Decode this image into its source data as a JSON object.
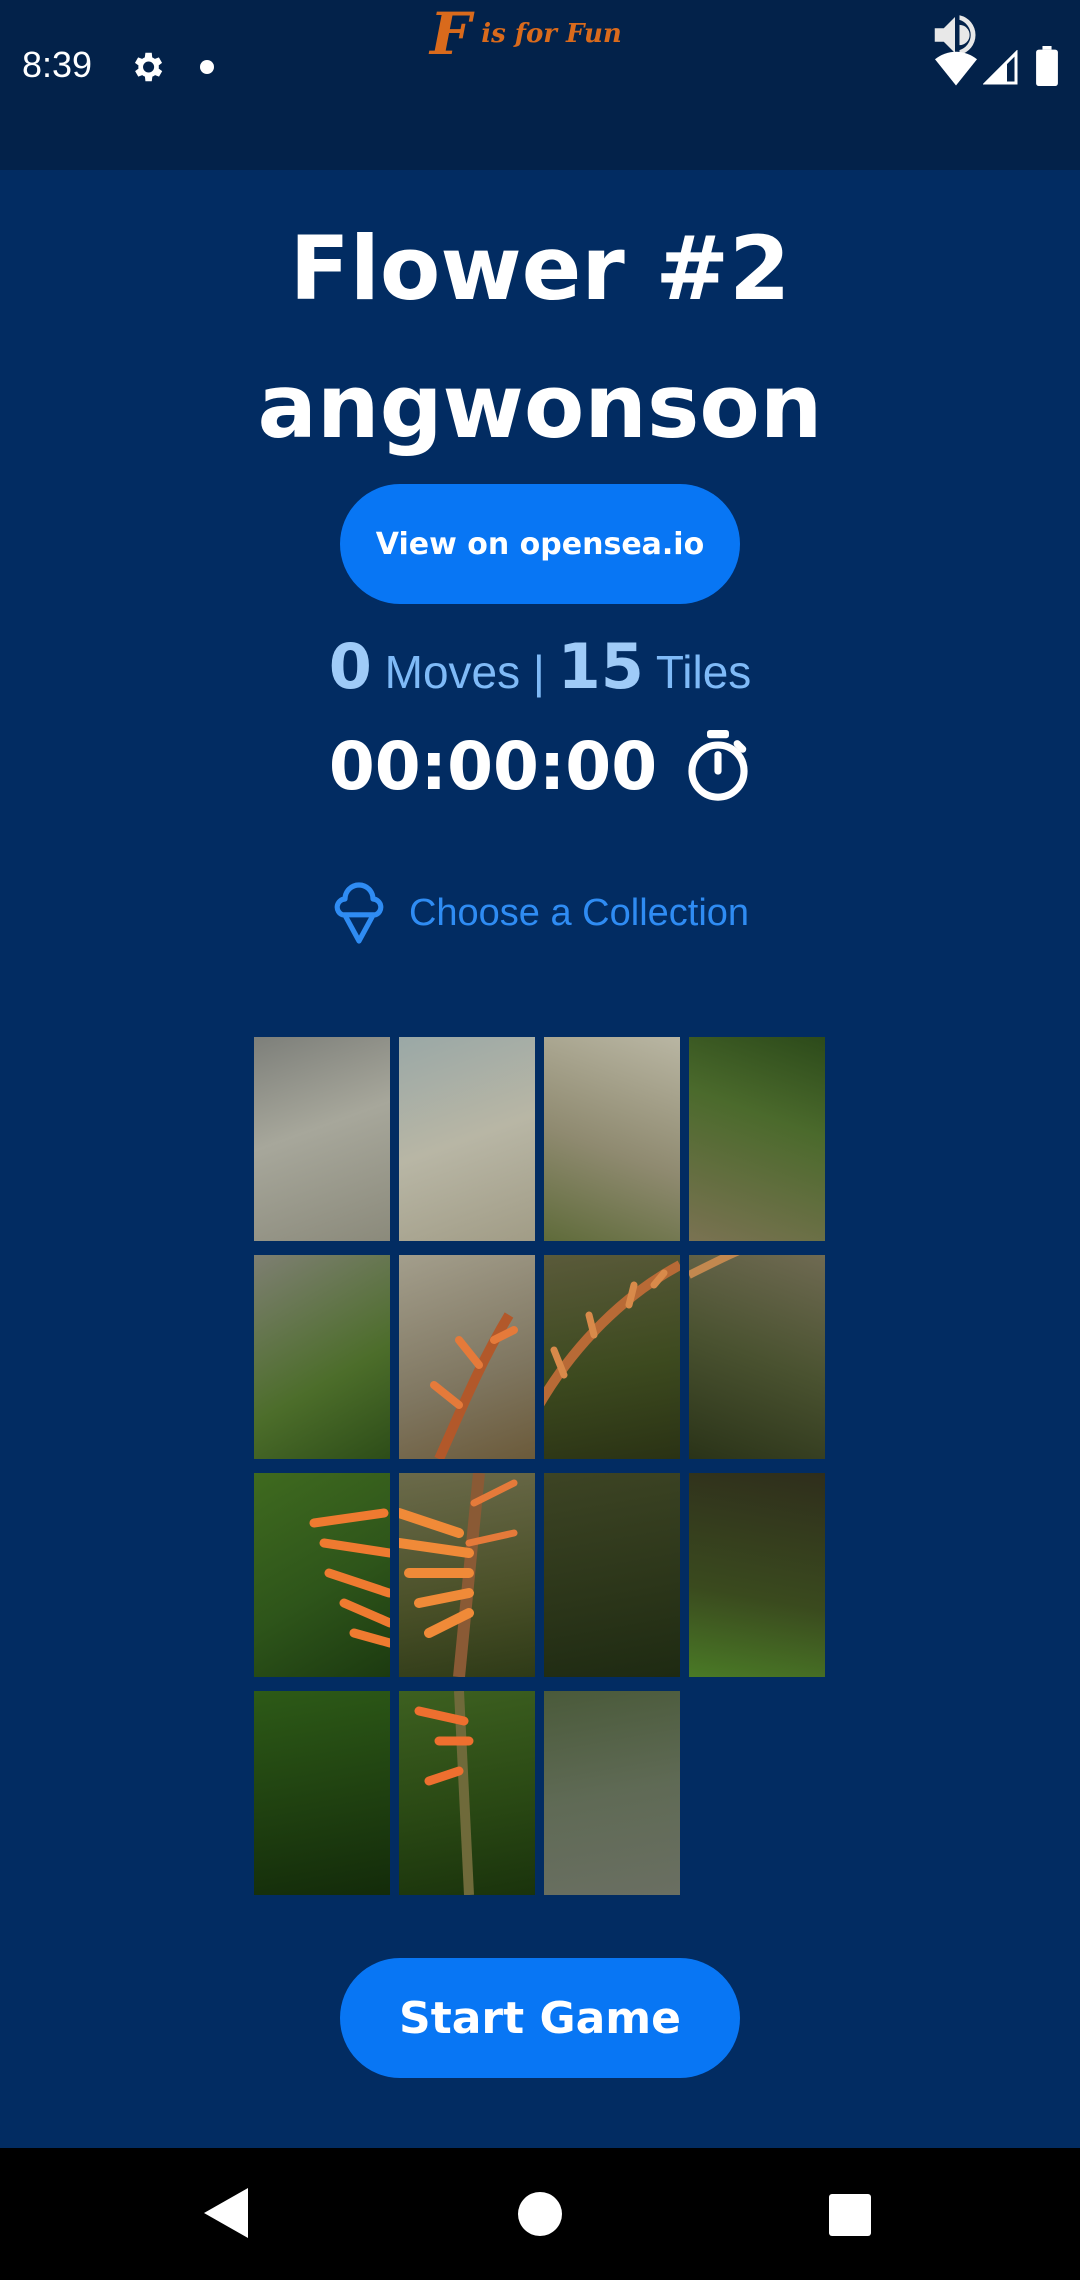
{
  "status_bar": {
    "time": "8:39",
    "icons": [
      "gear-icon",
      "dot-icon",
      "volume-icon",
      "wifi-icon",
      "signal-icon",
      "battery-icon"
    ]
  },
  "brand": {
    "logo_letter": "F",
    "logo_text": "is for Fun"
  },
  "header": {
    "title": "Flower #2",
    "artist": "angwonson"
  },
  "opensea_button": "View on opensea.io",
  "stats": {
    "moves_value": "0",
    "moves_label": "Moves",
    "separator": "|",
    "tiles_value": "15",
    "tiles_label": "Tiles"
  },
  "timer": "00:00:00",
  "collection_link": "Choose a Collection",
  "puzzle": {
    "grid_size": "4x4",
    "tile_count": 15,
    "empty_slot": "bottom-right"
  },
  "start_button": "Start Game",
  "colors": {
    "background": "#022c62",
    "status_bar": "#03224a",
    "button": "#0876f4",
    "link": "#2f8cf3",
    "stats_text": "#7fbaf7",
    "brand": "#d96a1c"
  },
  "nav": {
    "icons": [
      "back-icon",
      "home-icon",
      "recents-icon"
    ]
  }
}
